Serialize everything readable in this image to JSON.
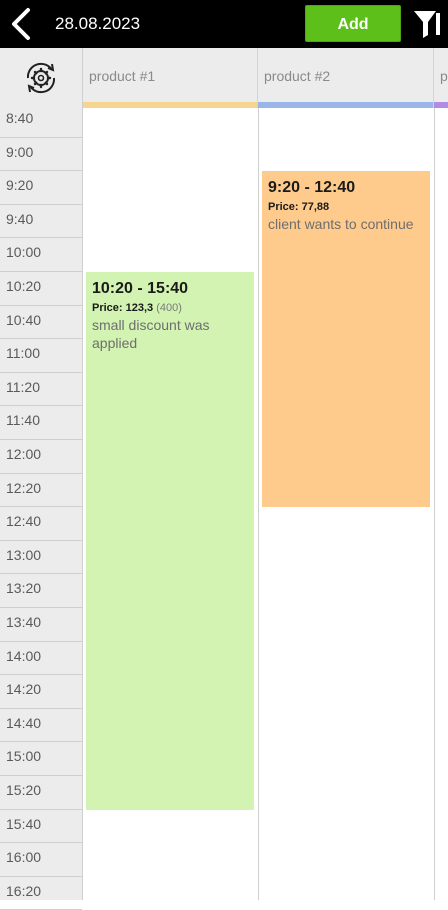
{
  "header": {
    "date": "28.08.2023",
    "add_label": "Add"
  },
  "columns": [
    {
      "label": "product #1",
      "color": "#f5d58f"
    },
    {
      "label": "product #2",
      "color": "#9ab6e8"
    },
    {
      "label": "p",
      "color": "#b28be6"
    }
  ],
  "times": [
    "8:40",
    "9:00",
    "9:20",
    "9:40",
    "10:00",
    "10:20",
    "10:40",
    "11:00",
    "11:20",
    "11:40",
    "12:00",
    "12:20",
    "12:40",
    "13:00",
    "13:20",
    "13:40",
    "14:00",
    "14:20",
    "14:40",
    "15:00",
    "15:20",
    "15:40",
    "16:00",
    "16:20"
  ],
  "events": [
    {
      "time": "10:20 - 15:40",
      "price_label": "Price: 123,3",
      "price_extra": "(400)",
      "note": "small discount was applied",
      "color": "#d2f3b1"
    },
    {
      "time": "9:20 - 12:40",
      "price_label": "Price: 77,88",
      "price_extra": "",
      "note": "client wants to continue",
      "color": "#ffcb8c"
    }
  ]
}
